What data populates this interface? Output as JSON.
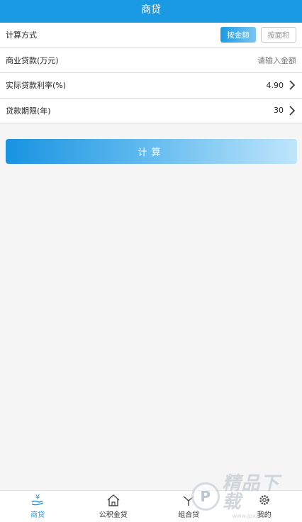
{
  "header": {
    "title": "商贷"
  },
  "calc_method": {
    "label": "计算方式",
    "options": [
      "按金额",
      "按面积"
    ],
    "selected": "按金额"
  },
  "loan_amount": {
    "label": "商业贷款(万元)",
    "placeholder": "请输入金额"
  },
  "interest_rate": {
    "label": "实际贷款利率(%)",
    "value": "4.90"
  },
  "loan_term": {
    "label": "贷款期限(年)",
    "value": "30"
  },
  "calculate_button": {
    "label": "计算"
  },
  "tabbar": {
    "items": [
      {
        "label": "商贷",
        "icon": "yen-hand-icon",
        "active": true
      },
      {
        "label": "公积金贷",
        "icon": "house-icon",
        "active": false
      },
      {
        "label": "组合贷",
        "icon": "combine-icon",
        "active": false
      },
      {
        "label": "我的",
        "icon": "gear-icon",
        "active": false
      }
    ]
  },
  "watermark": {
    "main": "精品下载",
    "sub": "www.jpxz.com"
  },
  "colors": {
    "accent": "#1a9ae3",
    "background": "#f5f5f5"
  }
}
